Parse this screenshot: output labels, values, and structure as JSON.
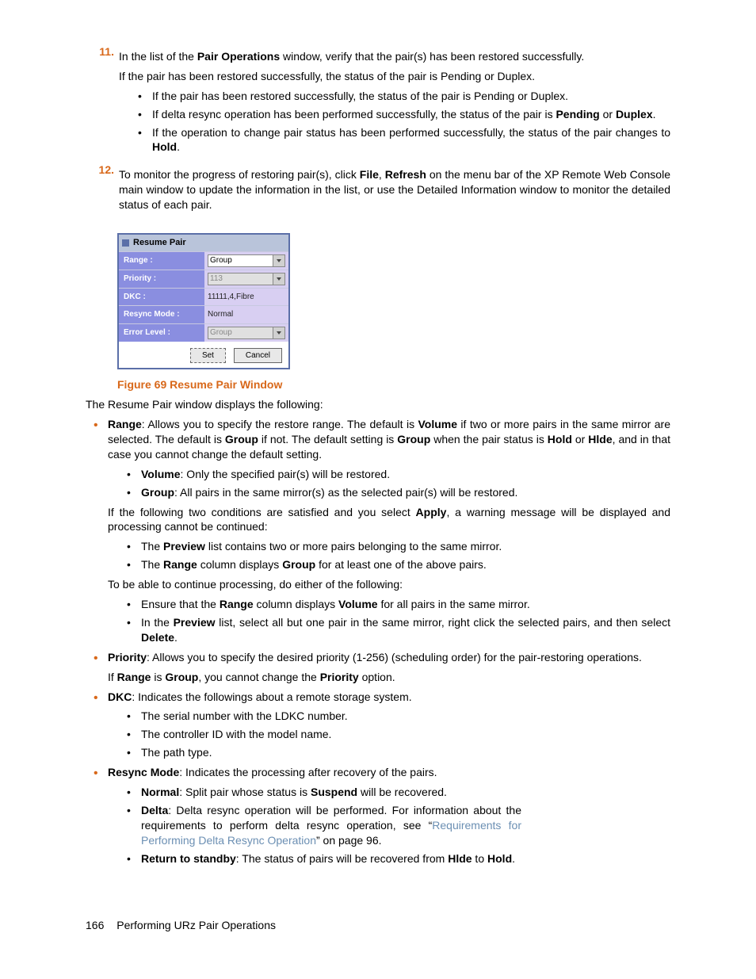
{
  "steps": {
    "s11": {
      "num": "11.",
      "line1_a": "In the list of the ",
      "line1_b": "Pair Operations",
      "line1_c": " window, verify that the pair(s) has been restored successfully.",
      "line2": "If the pair has been restored successfully, the status of the pair is Pending or Duplex.",
      "b1": "If the pair has been restored successfully, the status of the pair is Pending or Duplex.",
      "b2_a": "If delta resync operation has been performed successfully, the status of the pair is ",
      "b2_b": "Pending",
      "b2_c": " or ",
      "b2_d": "Duplex",
      "b2_e": ".",
      "b3_a": "If the operation to change pair status has been performed successfully, the status of the pair changes to ",
      "b3_b": "Hold",
      "b3_c": "."
    },
    "s12": {
      "num": "12.",
      "a": "To monitor the progress of restoring pair(s), click ",
      "b": "File",
      "c": ", ",
      "d": "Refresh",
      "e": " on the menu bar of the XP Remote Web Console main window to update the information in the list, or use the Detailed Information window to monitor the detailed status of each pair."
    }
  },
  "window": {
    "title": "Resume Pair",
    "rows": {
      "range": {
        "label": "Range :",
        "value": "Group"
      },
      "priority": {
        "label": "Priority :",
        "value": "113"
      },
      "dkc": {
        "label": "DKC :",
        "value": "11111,4,Fibre"
      },
      "resync": {
        "label": "Resync Mode :",
        "value": "Normal"
      },
      "error": {
        "label": "Error Level :",
        "value": "Group"
      }
    },
    "buttons": {
      "set": "Set",
      "cancel": "Cancel"
    }
  },
  "caption": "Figure 69 Resume Pair Window",
  "intro": "The Resume Pair window displays the following:",
  "items": {
    "range": {
      "t1": "Range",
      "t2": ": Allows you to specify the restore range. The default is ",
      "t3": "Volume",
      "t4": " if two or more pairs in the same mirror are selected. The default is ",
      "t5": "Group",
      "t6": " if not. The default setting is ",
      "t7": "Group",
      "t8": " when the pair status is ",
      "t9": "Hold",
      "t10": " or ",
      "t11": "Hlde",
      "t12": ", and in that case you cannot change the default setting.",
      "sub1_a": "Volume",
      "sub1_b": ": Only the specified pair(s) will be restored.",
      "sub2_a": "Group",
      "sub2_b": ": All pairs in the same mirror(s) as the selected pair(s) will be restored.",
      "p2_a": "If the following two conditions are satisfied and you select ",
      "p2_b": "Apply",
      "p2_c": ", a warning message will be displayed and processing cannot be continued:",
      "sub3_a": "The ",
      "sub3_b": "Preview",
      "sub3_c": " list contains two or more pairs belonging to the same mirror.",
      "sub4_a": "The ",
      "sub4_b": "Range",
      "sub4_c": " column displays ",
      "sub4_d": "Group",
      "sub4_e": " for at least one of the above pairs.",
      "p3": "To be able to continue processing, do either of the following:",
      "sub5_a": "Ensure that the ",
      "sub5_b": "Range",
      "sub5_c": " column displays ",
      "sub5_d": "Volume",
      "sub5_e": " for all pairs in the same mirror.",
      "sub6_a": "In the ",
      "sub6_b": "Preview",
      "sub6_c": " list, select all but one pair in the same mirror, right click the selected pairs, and then select ",
      "sub6_d": "Delete",
      "sub6_e": "."
    },
    "priority": {
      "t1": "Priority",
      "t2": ": Allows you to specify the desired priority (1-256) (scheduling order) for the pair-restoring operations.",
      "p_a": "If ",
      "p_b": "Range",
      "p_c": " is ",
      "p_d": "Group",
      "p_e": ", you cannot change the ",
      "p_f": "Priority",
      "p_g": " option."
    },
    "dkc": {
      "t1": "DKC",
      "t2": ": Indicates the followings about a remote storage system.",
      "s1": "The serial number with the LDKC number.",
      "s2": "The controller ID with the model name.",
      "s3": "The path type."
    },
    "resync": {
      "t1": "Resync Mode",
      "t2": ": Indicates the processing after recovery of the pairs.",
      "s1_a": "Normal",
      "s1_b": ": Split pair whose status is ",
      "s1_c": "Suspend",
      "s1_d": " will be recovered.",
      "s2_a": "Delta",
      "s2_b": ": Delta resync operation will be performed.  For information about the requirements to perform delta resync operation, see “",
      "s2_link": "Requirements for Performing Delta Resync Operation",
      "s2_c": "” on page 96.",
      "s3_a": "Return to standby",
      "s3_b": ": The status of pairs will be recovered from ",
      "s3_c": "Hlde",
      "s3_d": " to ",
      "s3_e": "Hold",
      "s3_f": "."
    }
  },
  "footer": {
    "page": "166",
    "title": "Performing URz Pair Operations"
  }
}
